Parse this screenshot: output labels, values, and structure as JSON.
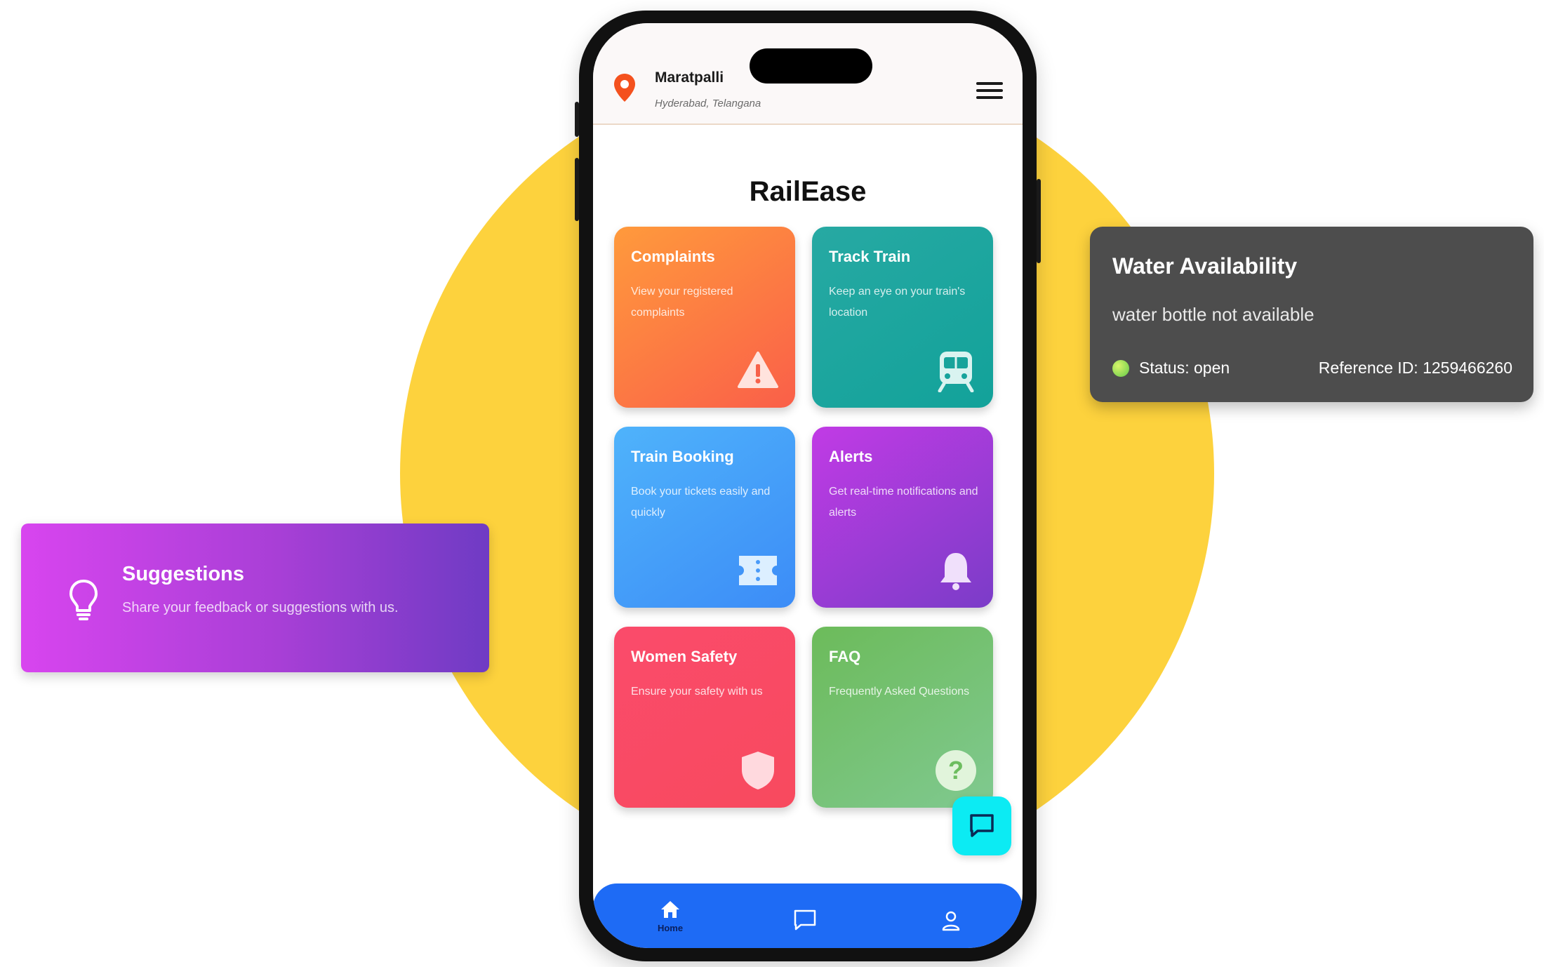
{
  "header": {
    "location_name": "Maratpalli",
    "location_sub": "Hyderabad, Telangana"
  },
  "app": {
    "title": "RailEase"
  },
  "cards": [
    {
      "title": "Complaints",
      "desc": "View your registered complaints",
      "icon": "warning-icon",
      "color_from": "#FF9A3C",
      "color_to": "#FA5F49"
    },
    {
      "title": "Track Train",
      "desc": "Keep an eye on your train's location",
      "icon": "train-icon",
      "color_from": "#27A9A3",
      "color_to": "#12A29A"
    },
    {
      "title": "Train Booking",
      "desc": "Book your tickets easily and quickly",
      "icon": "ticket-icon",
      "color_from": "#4FB3FB",
      "color_to": "#3C8CF7"
    },
    {
      "title": "Alerts",
      "desc": "Get real-time notifications and alerts",
      "icon": "bell-icon",
      "color_from": "#C13BE5",
      "color_to": "#7B3CC8"
    },
    {
      "title": "Women Safety",
      "desc": "Ensure your safety with us",
      "icon": "shield-icon",
      "color_from": "#FA4B6B",
      "color_to": "#F84A5E"
    },
    {
      "title": "FAQ",
      "desc": "Frequently Asked Questions",
      "icon": "question-icon",
      "color_from": "#6CBB5A",
      "color_to": "#80C990"
    }
  ],
  "bottom_nav": {
    "home_label": "Home"
  },
  "water_card": {
    "title": "Water Availability",
    "desc": "water bottle not available",
    "status": "Status: open",
    "reference": "Reference ID: 1259466260"
  },
  "suggestions_card": {
    "title": "Suggestions",
    "desc": "Share your feedback or suggestions with us."
  },
  "colors": {
    "yellow_bg": "#FDD23D",
    "nav_blue": "#1E6BF5",
    "fab_cyan": "#0CEBF3",
    "pin_orange": "#F4511E"
  }
}
